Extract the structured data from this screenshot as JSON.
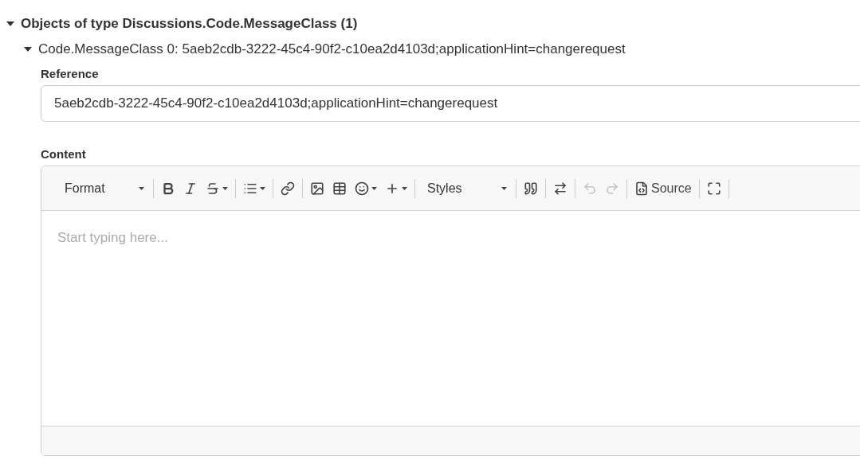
{
  "tree": {
    "label": "Objects of type Discussions.Code.MessageClass (1)",
    "expanded": true,
    "children": [
      {
        "label": "Code.MessageClass 0: 5aeb2cdb-3222-45c4-90f2-c10ea2d4103d;applicationHint=changerequest",
        "expanded": true,
        "fields": [
          {
            "kind": "text",
            "label": "Reference",
            "value": "5aeb2cdb-3222-45c4-90f2-c10ea2d4103d;applicationHint=changerequest"
          },
          {
            "kind": "editor",
            "label": "Content",
            "placeholder": "Start typing here...",
            "toolbar": [
              [
                {
                  "kind": "combo",
                  "label": "Format"
                }
              ],
              [
                {
                  "kind": "bold",
                  "dropdown": false,
                  "disabled": false
                },
                {
                  "kind": "italic",
                  "dropdown": false,
                  "disabled": false
                },
                {
                  "kind": "strike",
                  "dropdown": true,
                  "disabled": false
                }
              ],
              [
                {
                  "kind": "list",
                  "dropdown": true,
                  "disabled": false
                }
              ],
              [
                {
                  "kind": "link",
                  "dropdown": false,
                  "disabled": false
                }
              ],
              [
                {
                  "kind": "image",
                  "dropdown": false,
                  "disabled": false
                },
                {
                  "kind": "table",
                  "dropdown": false,
                  "disabled": false
                },
                {
                  "kind": "emoji",
                  "dropdown": true,
                  "disabled": false
                },
                {
                  "kind": "insert",
                  "dropdown": true,
                  "disabled": false
                }
              ],
              [
                {
                  "kind": "combo",
                  "label": "Styles"
                }
              ],
              [
                {
                  "kind": "quote",
                  "dropdown": false,
                  "disabled": false
                }
              ],
              [
                {
                  "kind": "textdir",
                  "dropdown": false,
                  "disabled": false
                }
              ],
              [
                {
                  "kind": "undo",
                  "dropdown": false,
                  "disabled": true
                },
                {
                  "kind": "redo",
                  "dropdown": false,
                  "disabled": true
                }
              ],
              [
                {
                  "kind": "source",
                  "label": "Source",
                  "dropdown": false,
                  "disabled": false
                }
              ],
              [
                {
                  "kind": "maximize",
                  "dropdown": false,
                  "disabled": false
                }
              ]
            ]
          }
        ]
      }
    ]
  }
}
